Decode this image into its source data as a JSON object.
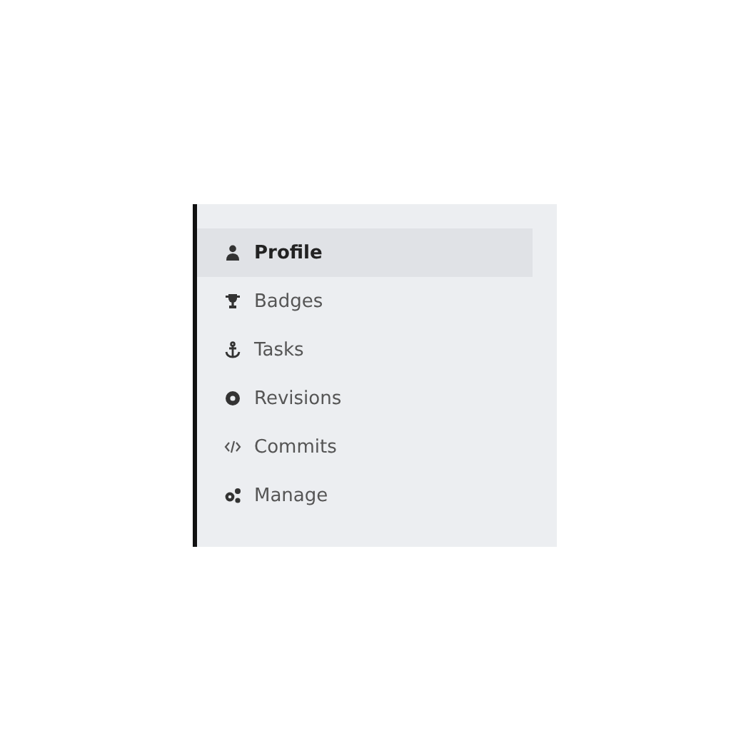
{
  "sidebar": {
    "items": [
      {
        "label": "Profile",
        "selected": true
      },
      {
        "label": "Badges",
        "selected": false
      },
      {
        "label": "Tasks",
        "selected": false
      },
      {
        "label": "Revisions",
        "selected": false
      },
      {
        "label": "Commits",
        "selected": false
      },
      {
        "label": "Manage",
        "selected": false
      }
    ]
  }
}
